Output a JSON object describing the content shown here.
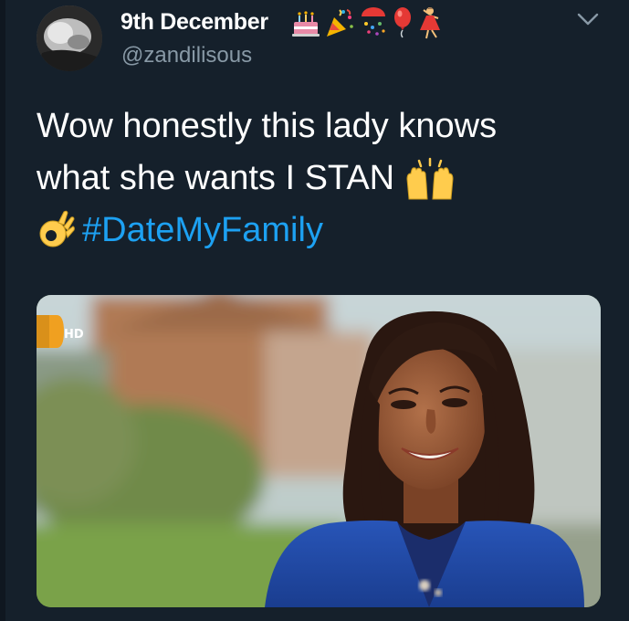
{
  "tweet": {
    "display_name": "9th December",
    "handle": "@zandilisous",
    "name_emojis": [
      "birthday-cake-icon",
      "party-popper-icon",
      "confetti-ball-icon",
      "balloon-icon",
      "dancer-icon"
    ],
    "text_line1": "Wow honestly this lady knows",
    "text_line2": "what she wants I STAN",
    "hashtag": "#DateMyFamily",
    "text_emojis": [
      "raising-hands-icon",
      "ok-hand-icon"
    ],
    "menu_icon": "chevron-down-icon"
  },
  "media": {
    "badge_text": "HD"
  },
  "colors": {
    "background": "#15202b",
    "text": "#ffffff",
    "secondary_text": "#8899a6",
    "link": "#1da1f2"
  }
}
